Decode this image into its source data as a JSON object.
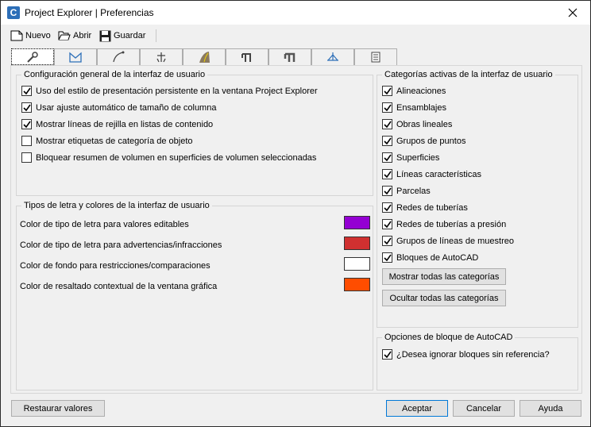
{
  "window": {
    "title": "Project Explorer | Preferencias",
    "app_icon_letter": "C"
  },
  "toolbar": {
    "new_label": "Nuevo",
    "open_label": "Abrir",
    "save_label": "Guardar"
  },
  "tabs": [
    {
      "icon": "wrench-icon",
      "selected": true
    },
    {
      "icon": "envelope-icon"
    },
    {
      "icon": "alignment-curve-icon"
    },
    {
      "icon": "assembly-icon"
    },
    {
      "icon": "road-icon"
    },
    {
      "icon": "pipe-network-icon"
    },
    {
      "icon": "pressure-pipe-icon"
    },
    {
      "icon": "sample-line-icon"
    },
    {
      "icon": "table-icon"
    }
  ],
  "general_settings": {
    "title": "Configuración general de la interfaz de usuario",
    "options": [
      {
        "label": "Uso del estilo de presentación persistente en la ventana Project Explorer",
        "checked": true
      },
      {
        "label": "Usar ajuste automático de tamaño de columna",
        "checked": true
      },
      {
        "label": "Mostrar líneas de rejilla en listas de contenido",
        "checked": true
      },
      {
        "label": "Mostrar etiquetas de categoría de objeto",
        "checked": false
      },
      {
        "label": "Bloquear resumen de volumen en superficies de volumen seleccionadas",
        "checked": false
      }
    ]
  },
  "fonts_colors": {
    "title": "Tipos de letra y colores de la interfaz de usuario",
    "items": [
      {
        "label": "Color de tipo de letra para valores editables",
        "color": "#9400d3"
      },
      {
        "label": "Color de tipo de letra para advertencias/infracciones",
        "color": "#d03030"
      },
      {
        "label": "Color de fondo para restricciones/comparaciones",
        "color": "#ffffff"
      },
      {
        "label": "Color de resaltado contextual de la ventana gráfica",
        "color": "#ff4d00"
      }
    ]
  },
  "categories": {
    "title": "Categorías activas de la interfaz de usuario",
    "items": [
      {
        "label": "Alineaciones",
        "checked": true
      },
      {
        "label": "Ensamblajes",
        "checked": true
      },
      {
        "label": "Obras lineales",
        "checked": true
      },
      {
        "label": "Grupos de puntos",
        "checked": true
      },
      {
        "label": "Superficies",
        "checked": true
      },
      {
        "label": "Líneas características",
        "checked": true
      },
      {
        "label": "Parcelas",
        "checked": true
      },
      {
        "label": "Redes de tuberías",
        "checked": true
      },
      {
        "label": "Redes de tuberías a presión",
        "checked": true
      },
      {
        "label": "Grupos de líneas de muestreo",
        "checked": true
      },
      {
        "label": "Bloques de AutoCAD",
        "checked": true
      }
    ],
    "show_all_label": "Mostrar todas las categorías",
    "hide_all_label": "Ocultar todas las categorías"
  },
  "block_options": {
    "title": "Opciones de bloque de AutoCAD",
    "ignore_label": "¿Desea ignorar bloques sin referencia?",
    "ignore_checked": true
  },
  "footer": {
    "restore_label": "Restaurar valores",
    "accept_label": "Aceptar",
    "cancel_label": "Cancelar",
    "help_label": "Ayuda"
  }
}
